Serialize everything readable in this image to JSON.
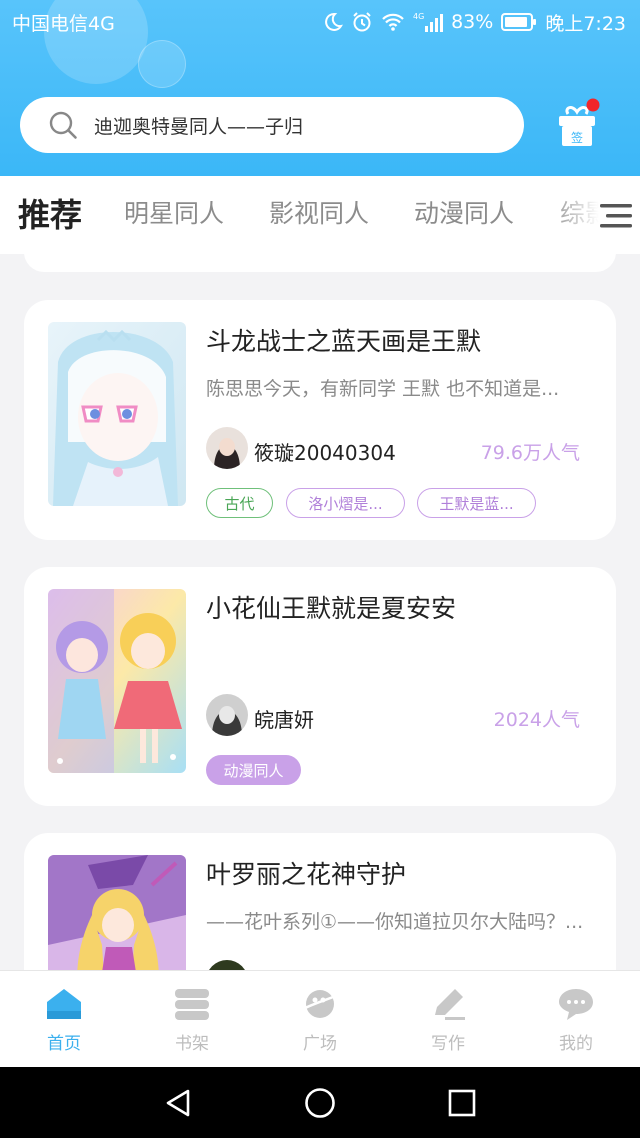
{
  "status_bar": {
    "carrier": "中国电信4G",
    "battery": "83%",
    "time": "晚上7:23",
    "network_badge": "4G"
  },
  "search": {
    "text": "迪迦奥特曼同人——子归",
    "icon": "search-icon"
  },
  "checkin": {
    "label": "签",
    "icon": "gift-icon",
    "dot_color": "#f0262a"
  },
  "tabs": [
    {
      "label": "推荐",
      "active": true
    },
    {
      "label": "明星同人",
      "active": false
    },
    {
      "label": "影视同人",
      "active": false
    },
    {
      "label": "动漫同人",
      "active": false
    },
    {
      "label": "综影",
      "active": false
    }
  ],
  "books": [
    {
      "title": "斗龙战士之蓝天画是王默",
      "desc": "陈思思今天，有新同学 王默 也不知道是...",
      "author": "筱璇20040304",
      "popularity": "79.6万人气",
      "tags": [
        {
          "label": "古代",
          "style": "green"
        },
        {
          "label": "洛小熠是...",
          "style": "purple"
        },
        {
          "label": "王默是蓝...",
          "style": "purple"
        }
      ]
    },
    {
      "title": "小花仙王默就是夏安安",
      "desc": "",
      "author": "皖唐妍",
      "popularity": "2024人气",
      "tags": [
        {
          "label": "动漫同人",
          "style": "filled"
        }
      ]
    },
    {
      "title": "叶罗丽之花神守护",
      "desc": "——花叶系列①——你知道拉贝尔大陆吗？...",
      "author": "",
      "popularity": "",
      "tags": []
    }
  ],
  "bottom_nav": [
    {
      "label": "首页",
      "icon": "home-icon",
      "active": true
    },
    {
      "label": "书架",
      "icon": "bookshelf-icon",
      "active": false
    },
    {
      "label": "广场",
      "icon": "planet-icon",
      "active": false
    },
    {
      "label": "写作",
      "icon": "write-icon",
      "active": false
    },
    {
      "label": "我的",
      "icon": "chat-bubble-icon",
      "active": false
    }
  ],
  "colors": {
    "header": "#3bb7f7",
    "accent": "#3bb0ee",
    "tag_purple": "#c9a1e8",
    "tag_green": "#6fc07a"
  }
}
